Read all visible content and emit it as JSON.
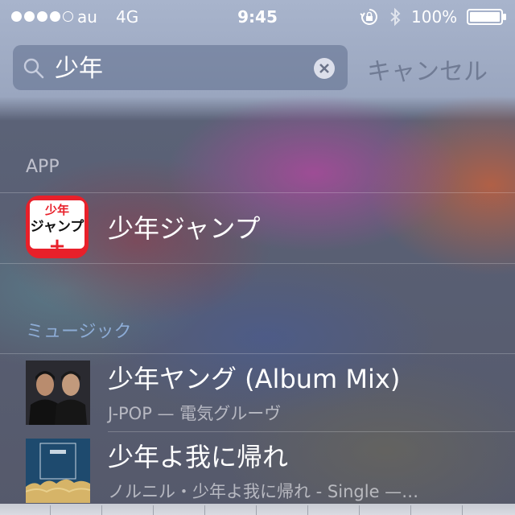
{
  "status_bar": {
    "signal_filled": 4,
    "signal_total": 5,
    "carrier": "au",
    "network": "4G",
    "time": "9:45",
    "battery_percent": "100%"
  },
  "search": {
    "query": "少年",
    "cancel_label": "キャンセル"
  },
  "sections": {
    "app_header": "APP",
    "music_header": "ミュージック"
  },
  "app_result": {
    "title": "少年ジャンプ",
    "icon_text_top": "少年",
    "icon_text_main": "ジャンプ",
    "icon_text_plus": "+"
  },
  "music_results": [
    {
      "title": "少年ヤング (Album Mix)",
      "subtitle": "J-POP — 電気グルーヴ"
    },
    {
      "title": "少年よ我に帰れ",
      "subtitle": "ノルニル・少年よ我に帰れ - Single —…"
    }
  ],
  "colors": {
    "accent_red": "#e8202a",
    "text_white": "#ffffff"
  }
}
